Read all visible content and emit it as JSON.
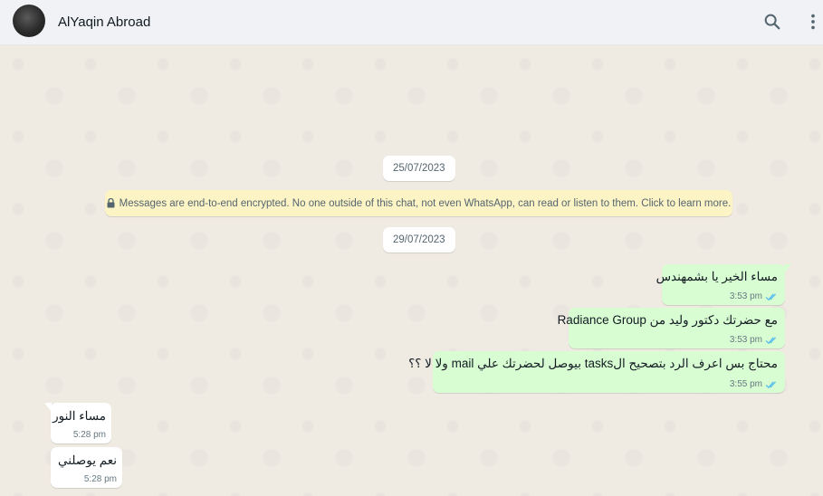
{
  "header": {
    "contact_name": "AlYaqin Abroad",
    "search_icon": "search-icon",
    "menu_icon": "more-vertical-icon"
  },
  "chat": {
    "date_1": "25/07/2023",
    "encryption_notice": "Messages are end-to-end encrypted. No one outside of this chat, not even WhatsApp, can read or listen to them. Click to learn more.",
    "date_2": "29/07/2023",
    "messages": [
      {
        "direction": "out",
        "text": "مساء الخير يا بشمهندس",
        "time": "3:53 pm",
        "status": "read"
      },
      {
        "direction": "out",
        "text": "مع حضرتك دكتور وليد من Radiance Group",
        "time": "3:53 pm",
        "status": "read"
      },
      {
        "direction": "out",
        "text": "محتاج بس اعرف الرد بتصحيح الtasks بيوصل لحضرتك علي mail ولا لا ؟؟",
        "time": "3:55 pm",
        "status": "read"
      },
      {
        "direction": "in",
        "text": "مساء النور",
        "time": "5:28 pm"
      },
      {
        "direction": "in",
        "text": "نعم يوصلني",
        "time": "5:28 pm"
      }
    ]
  },
  "colors": {
    "outgoing_bubble": "#d9fdd3",
    "incoming_bubble": "#ffffff",
    "read_ticks": "#53bdeb",
    "chat_background": "#efeae2",
    "encryption_bg": "#fdf4c5"
  }
}
